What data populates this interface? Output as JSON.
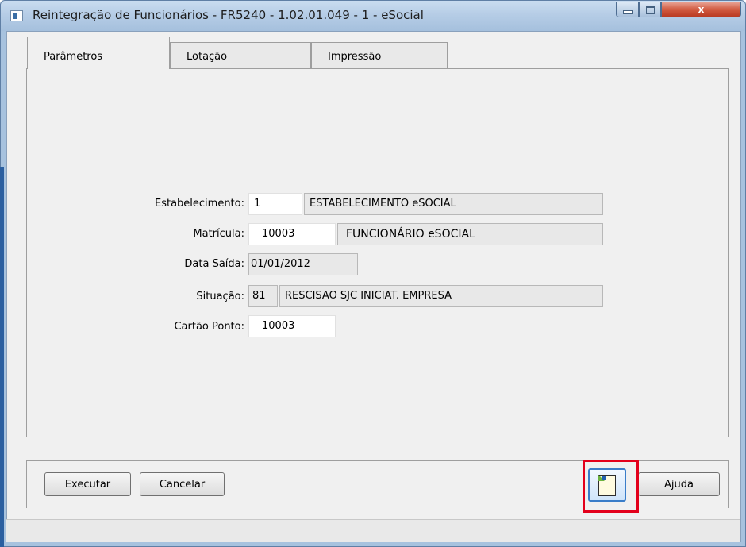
{
  "window": {
    "title": "Reintegração de Funcionários - FR5240 - 1.02.01.049 - 1 - eSocial",
    "controls": {
      "minimize": "",
      "maximize": "",
      "close": "x"
    }
  },
  "tabs": [
    {
      "label": "Parâmetros",
      "active": true
    },
    {
      "label": "Lotação",
      "active": false
    },
    {
      "label": "Impressão",
      "active": false
    }
  ],
  "form": {
    "estabelecimento": {
      "label": "Estabelecimento:",
      "code": "1",
      "description": "ESTABELECIMENTO eSOCIAL"
    },
    "matricula": {
      "label": "Matrícula:",
      "code": "10003",
      "description": "FUNCIONÁRIO eSOCIAL"
    },
    "data_saida": {
      "label": "Data Saída:",
      "value": "01/01/2012"
    },
    "situacao": {
      "label": "Situação:",
      "code": "81",
      "description": "RESCISAO SJC INICIAT. EMPRESA"
    },
    "cartao_ponto": {
      "label": "Cartão Ponto:",
      "value": "10003"
    }
  },
  "buttons": {
    "executar": "Executar",
    "cancelar": "Cancelar",
    "ajuda": "Ajuda"
  },
  "icons": {
    "document_button": "new-document-icon"
  },
  "colors": {
    "highlight": "#e3001b",
    "title_bar": "#b6cde6",
    "panel": "#f0f0f0"
  }
}
